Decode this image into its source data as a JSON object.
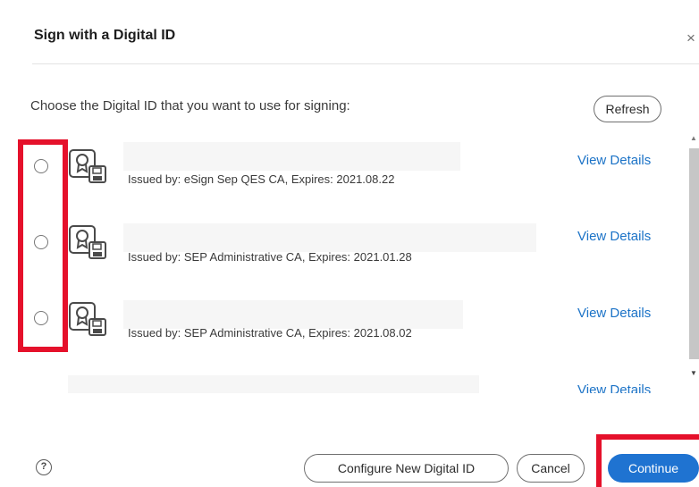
{
  "dialog": {
    "title": "Sign with a Digital ID",
    "close_glyph": "×",
    "prompt": "Choose the Digital ID that you want to use for signing:",
    "refresh_label": "Refresh",
    "help_glyph": "?"
  },
  "ids": [
    {
      "issued": "Issued by: eSign Sep QES CA, Expires: 2021.08.22",
      "details_label": "View Details",
      "selected": false
    },
    {
      "issued": "Issued by: SEP Administrative CA, Expires: 2021.01.28",
      "details_label": "View Details",
      "selected": false
    },
    {
      "issued": "Issued by: SEP Administrative CA, Expires: 2021.08.02",
      "details_label": "View Details",
      "selected": false
    },
    {
      "issued": "",
      "details_label": "View Details",
      "selected": false
    }
  ],
  "footer": {
    "configure_label": "Configure New Digital ID",
    "cancel_label": "Cancel",
    "continue_label": "Continue"
  },
  "icons": {
    "row_icon": "digital-id-certificate-icon",
    "close": "close-icon",
    "help": "help-icon"
  },
  "colors": {
    "accent": "#1f73d1",
    "link": "#1c73c7",
    "highlight": "#e5112b"
  }
}
